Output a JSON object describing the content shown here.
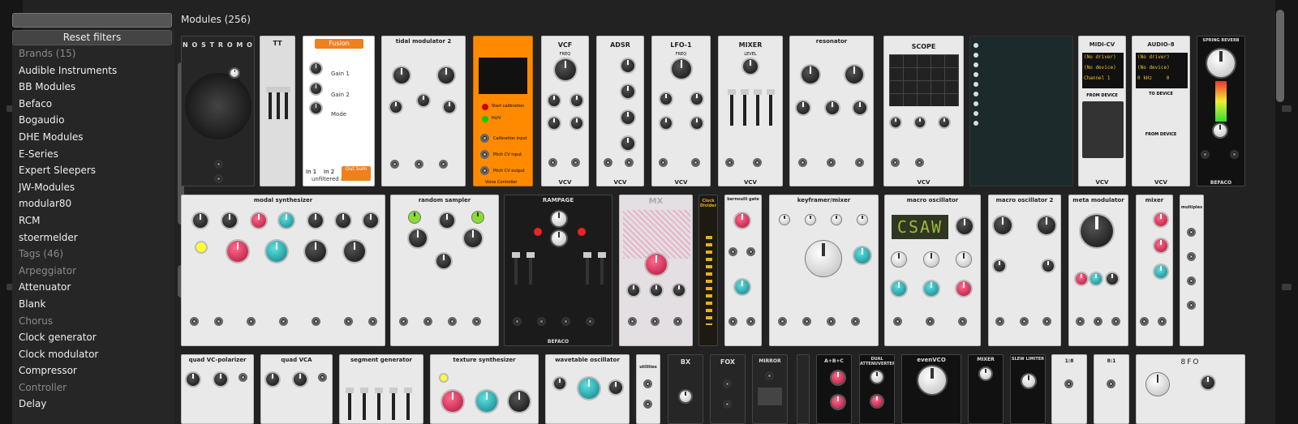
{
  "search": {
    "placeholder": ""
  },
  "header": {
    "title": "Modules (256)"
  },
  "sidebar": {
    "reset_label": "Reset filters",
    "brands_header": "Brands (15)",
    "brands": [
      "Audible Instruments",
      "BB Modules",
      "Befaco",
      "Bogaudio",
      "DHE Modules",
      "E-Series",
      "Expert Sleepers",
      "JW-Modules",
      "modular80",
      "RCM",
      "stoermelder"
    ],
    "tags_header": "Tags (46)",
    "tags": [
      {
        "label": "Arpeggiator",
        "disabled": true
      },
      {
        "label": "Attenuator",
        "disabled": false
      },
      {
        "label": "Blank",
        "disabled": false
      },
      {
        "label": "Chorus",
        "disabled": true
      },
      {
        "label": "Clock generator",
        "disabled": false
      },
      {
        "label": "Clock modulator",
        "disabled": false
      },
      {
        "label": "Compressor",
        "disabled": false
      },
      {
        "label": "Controller",
        "disabled": true
      },
      {
        "label": "Delay",
        "disabled": false
      }
    ]
  },
  "modules": {
    "nostromo": "N O S T R O M O",
    "tt": "TT",
    "fusion": "Fusion",
    "fusion_gain1": "Gain 1",
    "fusion_gain2": "Gain 2",
    "fusion_mode": "Mode",
    "fusion_brand": "unfiltered audio",
    "fusion_in1": "In 1",
    "fusion_in2": "In 2",
    "fusion_out": "Out",
    "fusion_sum": "Sum",
    "tidal": "tidal modulator 2",
    "voltage_title": "Start calibration",
    "voltage_hv": "Hz/V",
    "voltage_calin": "Calibration input",
    "voltage_pitchin": "Pitch CV input",
    "voltage_pitchout": "Pitch CV output",
    "voltage_name": "Voice Controller",
    "vcf": "VCF",
    "vcf_freq": "FREQ",
    "adsr": "ADSR",
    "lfo": "LFO-1",
    "lfo_freq": "FREQ",
    "mixer": "MIXER",
    "mixer_level": "LEVEL",
    "resonator": "resonator",
    "scope": "SCOPE",
    "midicv": "MIDI-CV",
    "midicv_d1": "(No driver)",
    "midicv_d2": "(No device)",
    "midicv_ch": "Channel 1",
    "audio8": "AUDIO-8",
    "audio8_d1": "(No driver)",
    "audio8_d2": "(No device)",
    "audio8_khz": "0 kHz",
    "audio8_n": "0",
    "todevice": "TO DEVICE",
    "fromdevice": "FROM DEVICE",
    "spring": "SPRING REVERB",
    "befaco": "BEFACO",
    "vcv": "VCV",
    "modal": "modal synthesizer",
    "random": "random sampler",
    "rampage": "RAMPAGE",
    "mx": "MX",
    "clockdiv": "Clock Divider",
    "bernoulli": "bernoulli gate",
    "keyframer": "keyframer/mixer",
    "macro": "macro oscillator",
    "macro_display": "CSAW",
    "macro2": "macro oscillator 2",
    "meta": "meta modulator",
    "mixer2": "mixer",
    "multiples": "multiples",
    "quadvc": "quad VC-polarizer",
    "quadvca": "quad VCA",
    "segment": "segment generator",
    "texture": "texture synthesizer",
    "wavetable": "wavetable oscillator",
    "utilities": "utilities",
    "bx": "BX",
    "fox": "FOX",
    "mirror": "MIRROR",
    "abc": "A+B+C",
    "dual": "DUAL ATTENUVERTER",
    "evenvco": "evenVCO",
    "mixer3": "MIXER",
    "slew": "SLEW LIMITER",
    "ratio1": "1:8",
    "ratio2": "8:1",
    "eightfo": "8FO"
  },
  "colors": {
    "orange": "#ff8a00",
    "pink": "#e0136c",
    "teal": "#0ea5b0",
    "red": "#d6102c"
  }
}
